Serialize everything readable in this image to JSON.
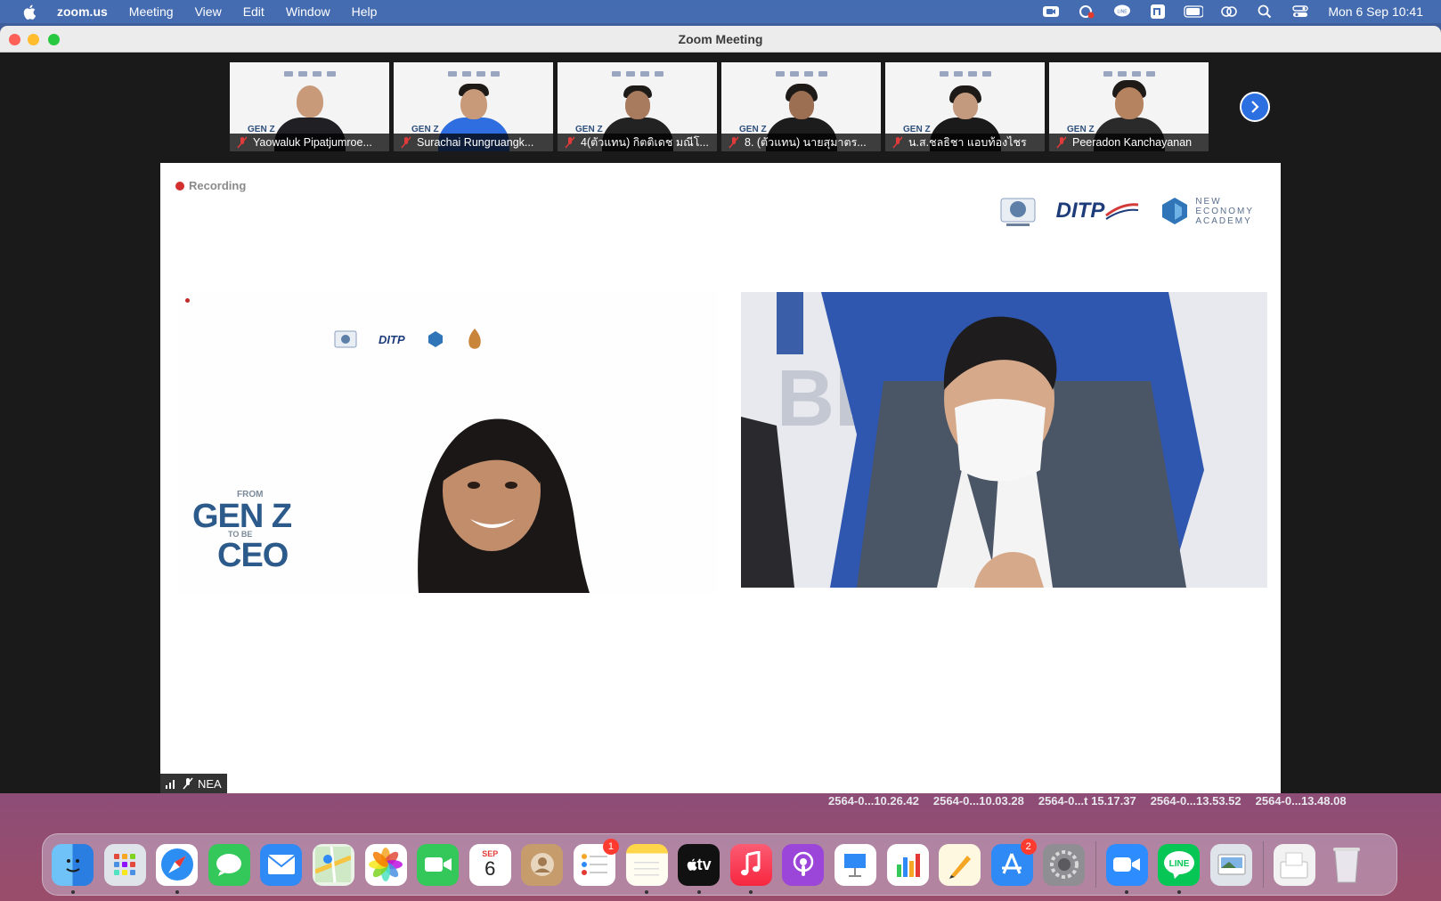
{
  "menubar": {
    "app_name": "zoom.us",
    "menus": [
      "Meeting",
      "View",
      "Edit",
      "Window",
      "Help"
    ],
    "clock": "Mon 6 Sep  10:41"
  },
  "window": {
    "title": "Zoom Meeting"
  },
  "participants": [
    {
      "name": "Yaowaluk Pipatjumroe..."
    },
    {
      "name": "Surachai Rungruangk..."
    },
    {
      "name": "4(ตัวแทน) กิตติเดช มณีโ..."
    },
    {
      "name": "8. (ตัวแทน) นายสุมาตร..."
    },
    {
      "name": "น.ส.ชลธิชา แอบท้องไชร"
    },
    {
      "name": "Peeradon Kanchayanan"
    }
  ],
  "main_view": {
    "recording_label": "Recording",
    "sponsor_ditp": "DITP",
    "sponsor_nea": [
      "NEW",
      "ECONOMY",
      "ACADEMY"
    ],
    "left_ditp": "DITP",
    "genz": {
      "from": "FROM",
      "genz": "GEN Z",
      "tobe": "TO BE",
      "ceo": "CEO"
    },
    "active_speaker_label": "NEA"
  },
  "desktop_files": [
    "2564-0...10.26.42",
    "2564-0...10.03.28",
    "2564-0...t 15.17.37",
    "2564-0...13.53.52",
    "2564-0...13.48.08"
  ],
  "dock": {
    "calendar_month": "SEP",
    "calendar_day": "6",
    "reminders_badge": "1",
    "appstore_badge": "2",
    "tv_label": "tv",
    "line_label": "LINE"
  },
  "colors": {
    "accent": "#2b6fe0",
    "recording": "#d22f2f",
    "brand_blue": "#1e3c7a"
  }
}
